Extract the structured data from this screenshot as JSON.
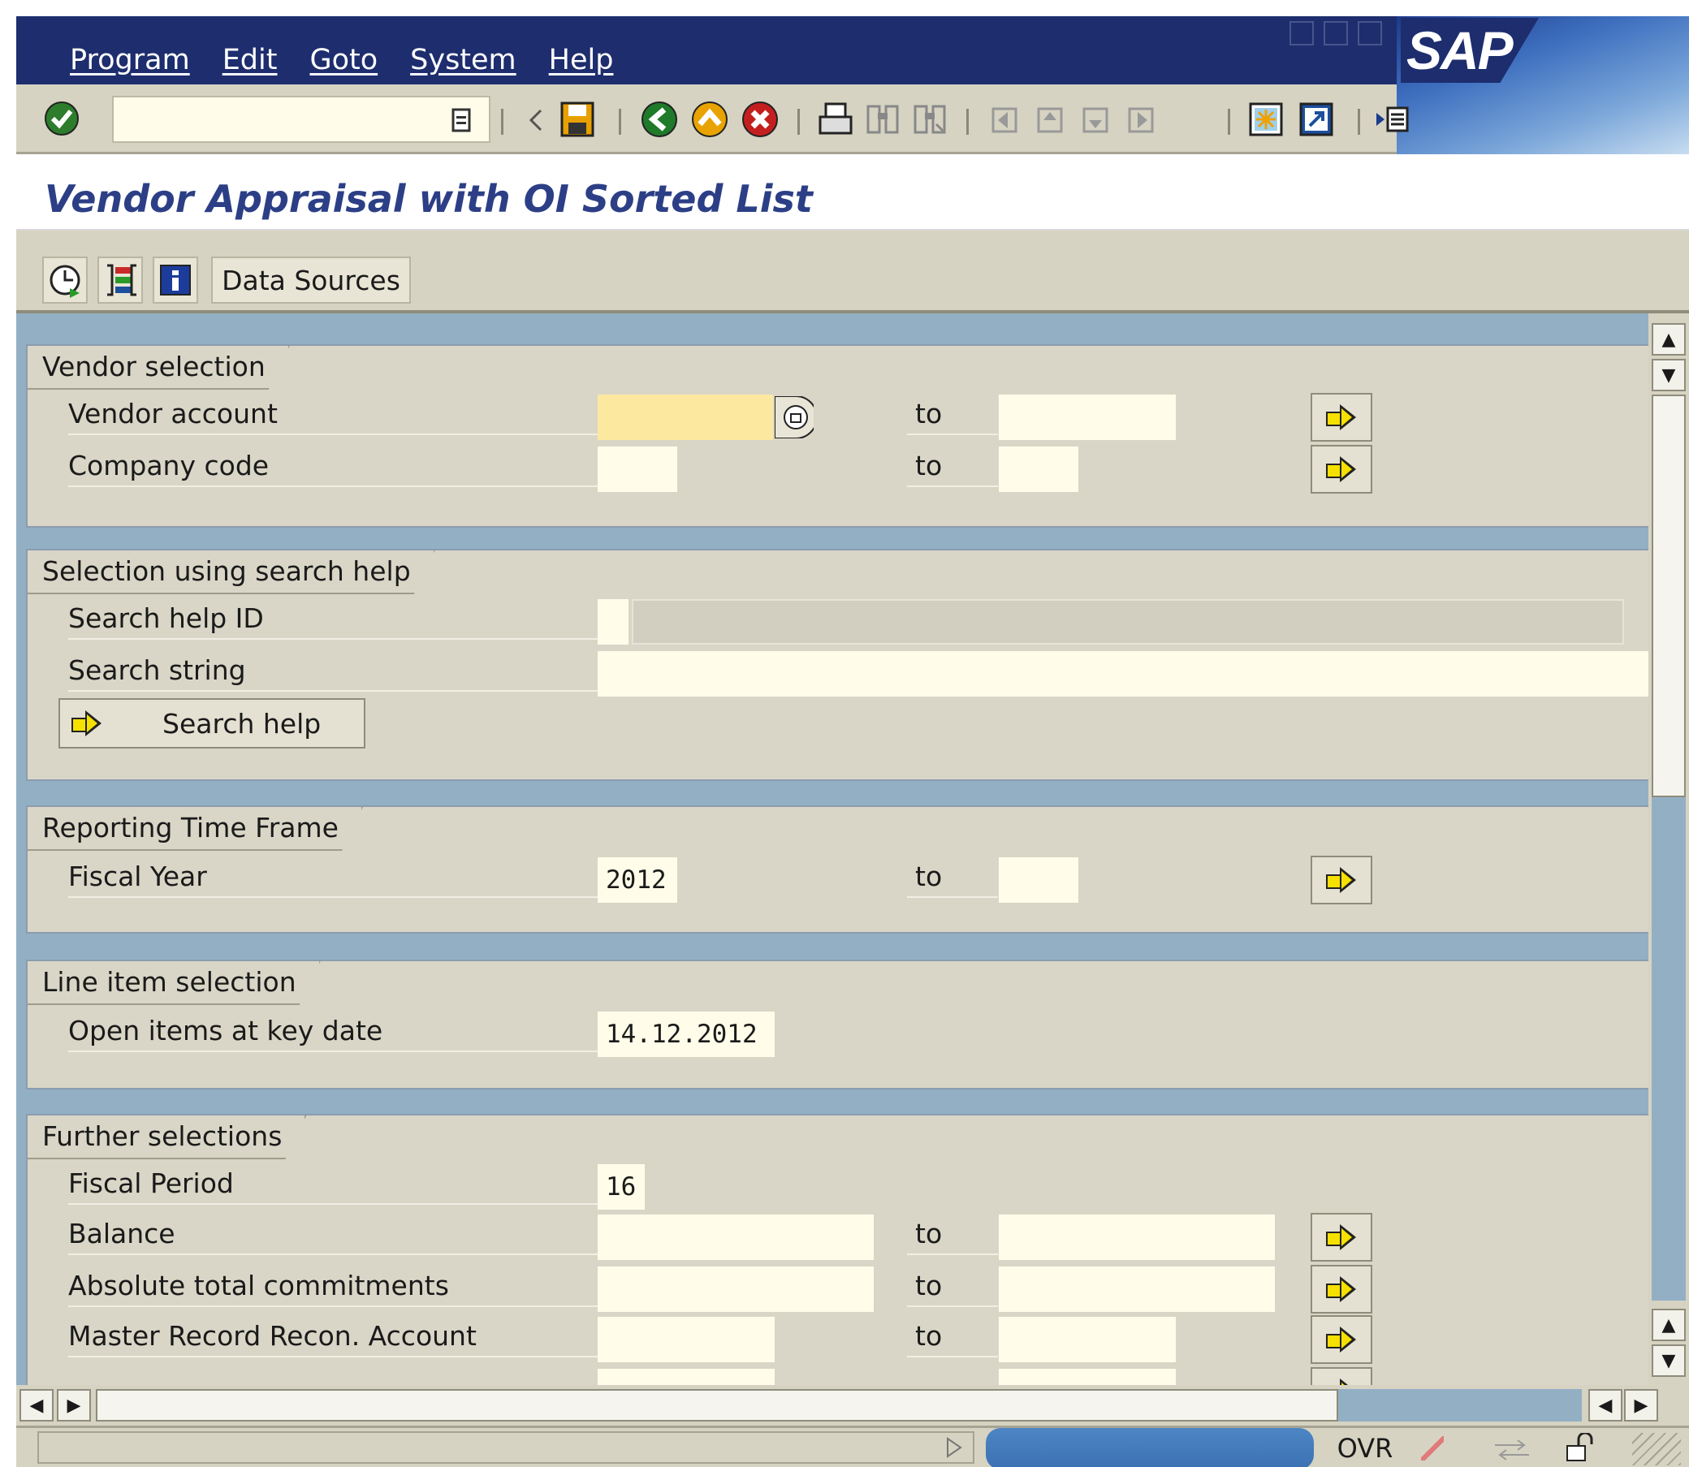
{
  "menu": [
    "Program",
    "Edit",
    "Goto",
    "System",
    "Help"
  ],
  "brand": "SAP",
  "toolbar": {
    "command_field_value": "",
    "icons": [
      "enter-icon",
      "command-dropdown-icon",
      "back-triangle-icon",
      "save-icon",
      "back-icon",
      "exit-icon",
      "cancel-icon",
      "print-icon",
      "find-icon",
      "find-next-icon",
      "first-page-icon",
      "previous-page-icon",
      "next-page-icon",
      "last-page-icon",
      "create-session-icon",
      "shortcut-icon",
      "help-icon"
    ]
  },
  "page_title": "Vendor Appraisal with OI Sorted List",
  "app_toolbar": {
    "icons": [
      "execute-icon",
      "variants-icon",
      "info-icon"
    ],
    "data_sources_label": "Data Sources"
  },
  "to_label": "to",
  "vendor_selection": {
    "title": "Vendor selection",
    "vendor_account_label": "Vendor account",
    "vendor_account_from": "",
    "vendor_account_to": "",
    "company_code_label": "Company code",
    "company_code_from": "",
    "company_code_to": ""
  },
  "search_help": {
    "title": "Selection using search help",
    "id_label": "Search help ID",
    "id_value": "",
    "string_label": "Search string",
    "string_value": "",
    "button_label": "Search help"
  },
  "time_frame": {
    "title": "Reporting Time Frame",
    "fiscal_year_label": "Fiscal Year",
    "fiscal_year_from": "2012",
    "fiscal_year_to": ""
  },
  "line_item": {
    "title": "Line item selection",
    "open_items_label": "Open items at key date",
    "open_items_value": "14.12.2012"
  },
  "further": {
    "title": "Further selections",
    "fiscal_period_label": "Fiscal Period",
    "fiscal_period_value": "16",
    "balance_label": "Balance",
    "abs_commitments_label": "Absolute total commitments",
    "master_record_label": "Master Record Recon. Account"
  },
  "status_bar": {
    "mode": "OVR"
  }
}
